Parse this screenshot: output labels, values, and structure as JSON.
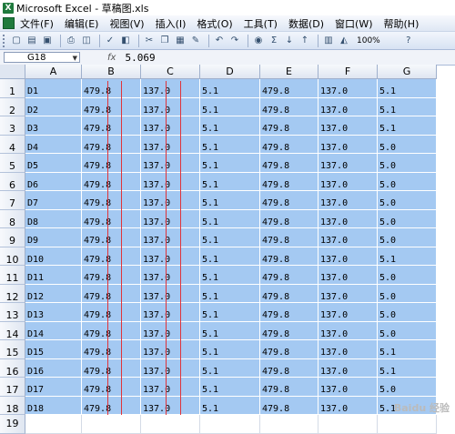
{
  "window": {
    "title": "Microsoft Excel - 草稿图.xls"
  },
  "menu": {
    "items": [
      "文件(F)",
      "编辑(E)",
      "视图(V)",
      "插入(I)",
      "格式(O)",
      "工具(T)",
      "数据(D)",
      "窗口(W)",
      "帮助(H)"
    ]
  },
  "toolbar": {
    "zoom": "100%"
  },
  "formula_bar": {
    "name_box": "G18",
    "fx": "fx",
    "value": "5.069"
  },
  "sheet": {
    "columns": [
      "A",
      "B",
      "C",
      "D",
      "E",
      "F",
      "G"
    ],
    "rows": [
      [
        "1",
        "D1",
        "479.8",
        "137.0",
        "5.1",
        "479.8",
        "137.0",
        "5.1"
      ],
      [
        "2",
        "D2",
        "479.8",
        "137.0",
        "5.1",
        "479.8",
        "137.0",
        "5.1"
      ],
      [
        "3",
        "D3",
        "479.8",
        "137.0",
        "5.1",
        "479.8",
        "137.0",
        "5.1"
      ],
      [
        "4",
        "D4",
        "479.8",
        "137.0",
        "5.1",
        "479.8",
        "137.0",
        "5.0"
      ],
      [
        "5",
        "D5",
        "479.8",
        "137.0",
        "5.1",
        "479.8",
        "137.0",
        "5.0"
      ],
      [
        "6",
        "D6",
        "479.8",
        "137.0",
        "5.1",
        "479.8",
        "137.0",
        "5.0"
      ],
      [
        "7",
        "D7",
        "479.8",
        "137.0",
        "5.1",
        "479.8",
        "137.0",
        "5.0"
      ],
      [
        "8",
        "D8",
        "479.8",
        "137.0",
        "5.1",
        "479.8",
        "137.0",
        "5.0"
      ],
      [
        "9",
        "D9",
        "479.8",
        "137.0",
        "5.1",
        "479.8",
        "137.0",
        "5.0"
      ],
      [
        "10",
        "D10",
        "479.8",
        "137.0",
        "5.1",
        "479.8",
        "137.0",
        "5.1"
      ],
      [
        "11",
        "D11",
        "479.8",
        "137.0",
        "5.1",
        "479.8",
        "137.0",
        "5.0"
      ],
      [
        "12",
        "D12",
        "479.8",
        "137.0",
        "5.1",
        "479.8",
        "137.0",
        "5.0"
      ],
      [
        "13",
        "D13",
        "479.8",
        "137.0",
        "5.1",
        "479.8",
        "137.0",
        "5.0"
      ],
      [
        "14",
        "D14",
        "479.8",
        "137.0",
        "5.1",
        "479.8",
        "137.0",
        "5.0"
      ],
      [
        "15",
        "D15",
        "479.8",
        "137.0",
        "5.1",
        "479.8",
        "137.0",
        "5.1"
      ],
      [
        "16",
        "D16",
        "479.8",
        "137.0",
        "5.1",
        "479.8",
        "137.0",
        "5.1"
      ],
      [
        "17",
        "D17",
        "479.8",
        "137.0",
        "5.1",
        "479.8",
        "137.0",
        "5.0"
      ],
      [
        "18",
        "D18",
        "479.8",
        "137.0",
        "5.1",
        "479.8",
        "137.0",
        "5.1"
      ]
    ],
    "extra_row_labels": [
      "19"
    ]
  },
  "watermark": "Baidu 经验"
}
